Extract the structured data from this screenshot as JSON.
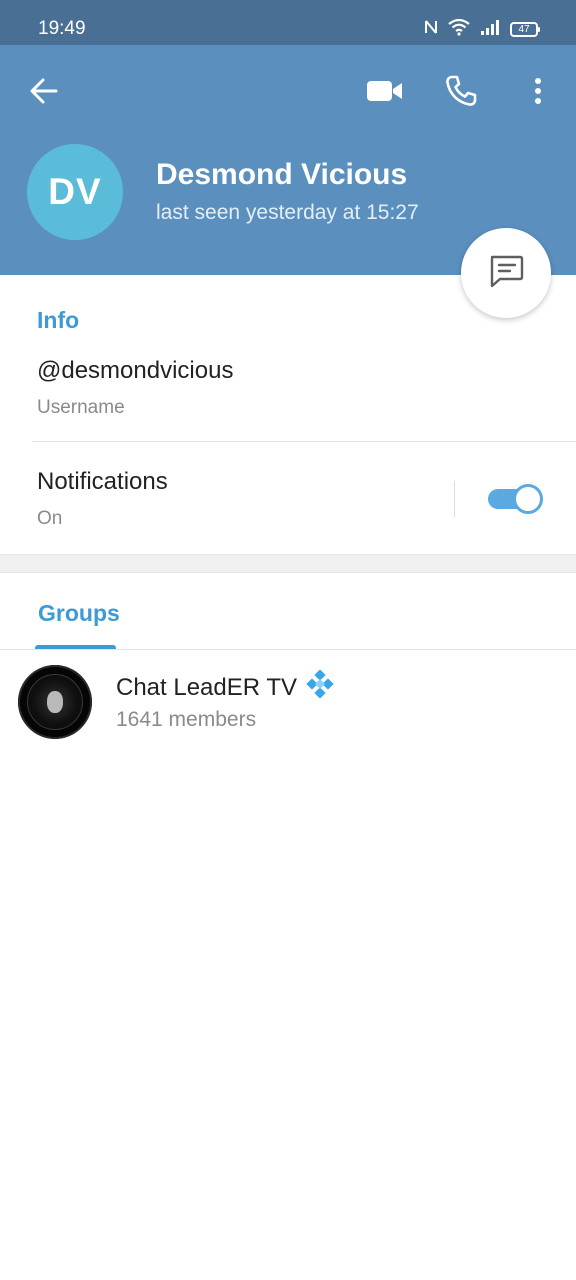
{
  "status_bar": {
    "time": "19:49",
    "battery": "47",
    "icons": [
      "nfc-icon",
      "wifi-icon",
      "signal-icon",
      "battery-icon"
    ]
  },
  "header": {
    "icons": [
      "back-arrow-icon",
      "video-camera-icon",
      "phone-icon",
      "more-vert-icon"
    ],
    "avatar_initials": "DV",
    "name": "Desmond Vicious",
    "status": "last seen yesterday at 15:27"
  },
  "fab": {
    "icon": "chat-message-icon"
  },
  "info": {
    "title": "Info",
    "username_value": "@desmondvicious",
    "username_label": "Username",
    "notifications_label": "Notifications",
    "notifications_value": "On",
    "notifications_enabled": true
  },
  "groups": {
    "tab_label": "Groups",
    "items": [
      {
        "name": "Chat LeadER TV",
        "members": "1641 members",
        "emoji_icon": "blue-diamond-emoji-icon"
      }
    ]
  },
  "colors": {
    "header_bg": "#5b8fbe",
    "status_bar_bg": "#496f94",
    "avatar_bg": "#5bbcd9",
    "accent": "#3d9ad6",
    "toggle_on": "#5aa9e0"
  }
}
